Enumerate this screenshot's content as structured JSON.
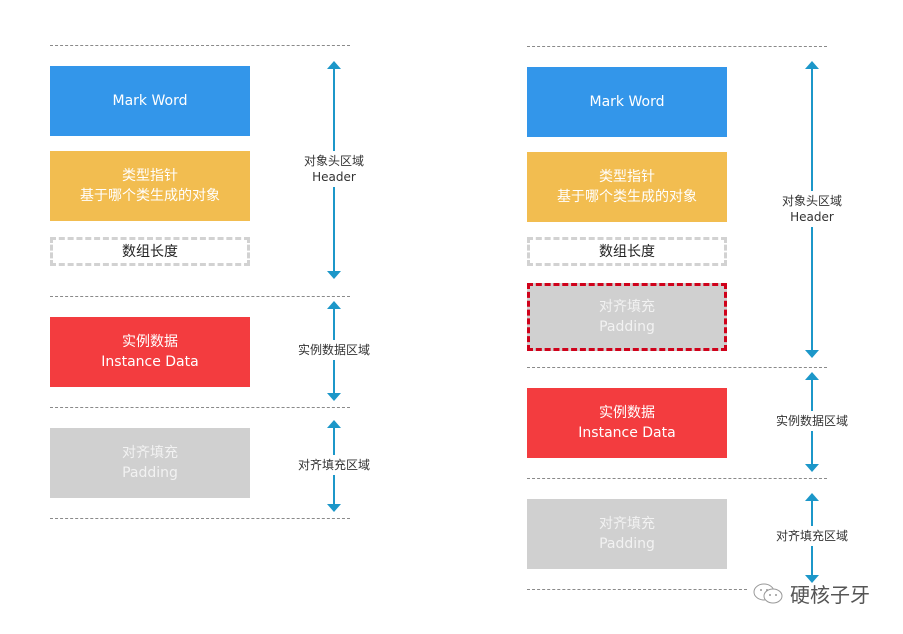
{
  "diagrams": [
    {
      "name": "without-array-padding",
      "blocks": {
        "mark_word": "Mark Word",
        "klass_pointer": [
          "类型指针",
          "基于哪个类生成的对象"
        ],
        "array_length": "数组长度",
        "instance_data": [
          "实例数据",
          "Instance Data"
        ],
        "padding": [
          "对齐填充",
          "Padding"
        ]
      },
      "regions": {
        "header": [
          "对象头区域",
          "Header"
        ],
        "instance": "实例数据区域",
        "padding": "对齐填充区域"
      }
    },
    {
      "name": "with-header-padding",
      "blocks": {
        "mark_word": "Mark Word",
        "klass_pointer": [
          "类型指针",
          "基于哪个类生成的对象"
        ],
        "array_length": "数组长度",
        "header_padding": [
          "对齐填充",
          "Padding"
        ],
        "instance_data": [
          "实例数据",
          "Instance Data"
        ],
        "padding": [
          "对齐填充",
          "Padding"
        ]
      },
      "regions": {
        "header": [
          "对象头区域",
          "Header"
        ],
        "instance": "实例数据区域",
        "padding": "对齐填充区域"
      }
    }
  ],
  "colors": {
    "mark_word": "#3396ea",
    "klass_pointer": "#f2bd50",
    "instance_data": "#f33c3f",
    "padding": "#d0d0d0",
    "highlight_border": "#d0021b",
    "arrow": "#1c97c9"
  },
  "watermark": {
    "icon": "wechat-icon",
    "text": "硬核子牙"
  }
}
